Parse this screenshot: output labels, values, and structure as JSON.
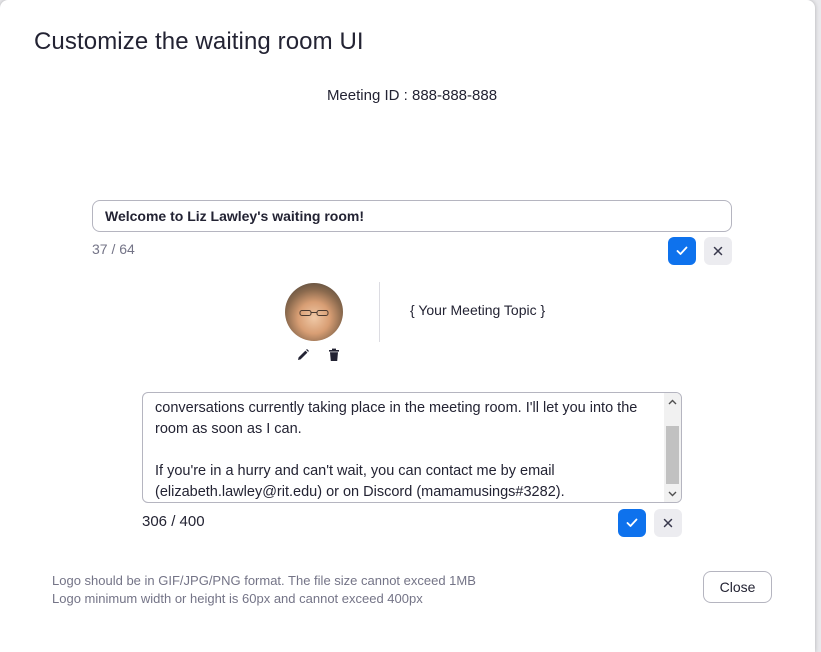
{
  "dialog": {
    "title": "Customize the waiting room UI",
    "meeting_id": "Meeting ID : 888-888-888"
  },
  "welcome": {
    "value": "Welcome to Liz Lawley's waiting room!",
    "count": "37 / 64"
  },
  "logo": {
    "edit_icon": "pencil-icon",
    "delete_icon": "trash-icon"
  },
  "topic": {
    "text": "{ Your Meeting Topic }"
  },
  "description": {
    "text": "conversations currently taking place in the meeting room. I'll let you into the room as soon as I can.\n\nIf you're in a hurry and can't wait, you can contact me by email (elizabeth.lawley@rit.edu) or on Discord (mamamusings#3282).",
    "count": "306 / 400"
  },
  "footer": {
    "note_line1": "Logo should be in GIF/JPG/PNG format. The file size cannot exceed 1MB",
    "note_line2": "Logo minimum width or height is 60px and cannot exceed 400px",
    "close_label": "Close"
  },
  "colors": {
    "accent": "#0e72ed",
    "text": "#232333",
    "muted": "#747487"
  }
}
